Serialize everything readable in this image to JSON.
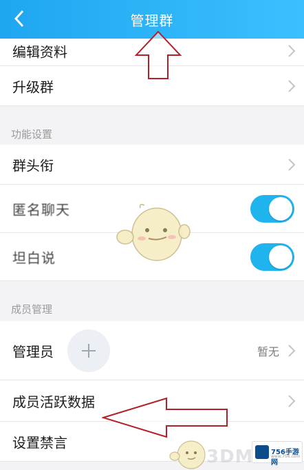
{
  "header": {
    "title": "管理群"
  },
  "rows_top": [
    {
      "label": "编辑资料"
    },
    {
      "label": "升级群"
    }
  ],
  "section_function": {
    "label": "功能设置"
  },
  "rows_function": [
    {
      "label": "群头衔"
    },
    {
      "label": "匿名聊天",
      "toggle": true
    },
    {
      "label": "坦白说",
      "toggle": true
    }
  ],
  "section_members": {
    "label": "成员管理"
  },
  "rows_members": [
    {
      "label": "管理员",
      "value": "暂无"
    },
    {
      "label": "成员活跃数据"
    },
    {
      "label": "设置禁言"
    }
  ],
  "watermark": {
    "text": "3DM",
    "logo_text": "756手游网",
    "logo_url": "www.756.com"
  },
  "colors": {
    "header": "#1ea6f0",
    "toggle_on": "#1fb4ee",
    "arrow": "#b3202a"
  }
}
